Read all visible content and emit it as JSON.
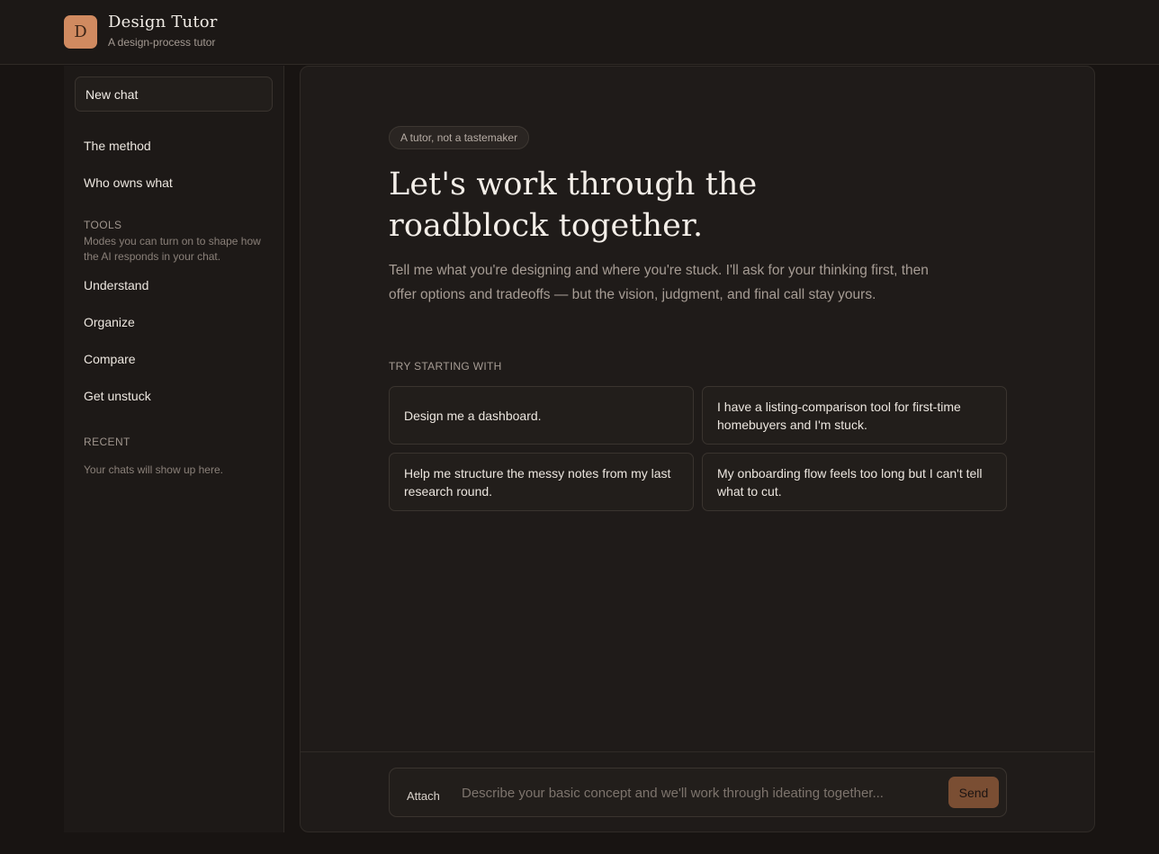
{
  "app": {
    "logo_letter": "D",
    "title": "Design Tutor",
    "subtitle": "A design-process tutor"
  },
  "sidebar": {
    "new_chat": "New chat",
    "nav": [
      "The method",
      "Who owns what"
    ],
    "tools_label": "TOOLS",
    "tools_desc": "Modes you can turn on to shape how the AI responds in your chat.",
    "tools": [
      "Understand",
      "Organize",
      "Compare",
      "Get unstuck"
    ],
    "recent_label": "RECENT",
    "recent_empty": "Your chats will show up here."
  },
  "main": {
    "badge": "A tutor, not a tastemaker",
    "headline": "Let's work through the roadblock together.",
    "intro": "Tell me what you're designing and where you're stuck. I'll ask for your thinking first, then offer options and tradeoffs — but the vision, judgment, and final call stay yours.",
    "try_label": "TRY STARTING WITH",
    "suggestions": [
      "Design me a dashboard.",
      "I have a listing-comparison tool for first-time homebuyers and I'm stuck.",
      "Help me structure the messy notes from my last research round.",
      "My onboarding flow feels too long but I can't tell what to cut."
    ]
  },
  "composer": {
    "attach_label": "Attach",
    "placeholder": "Describe your basic concept and we'll work through ideating together...",
    "value": "",
    "send_label": "Send"
  },
  "colors": {
    "accent": "#d08a60",
    "send_button": "#7a4e33",
    "background": "#181412"
  }
}
